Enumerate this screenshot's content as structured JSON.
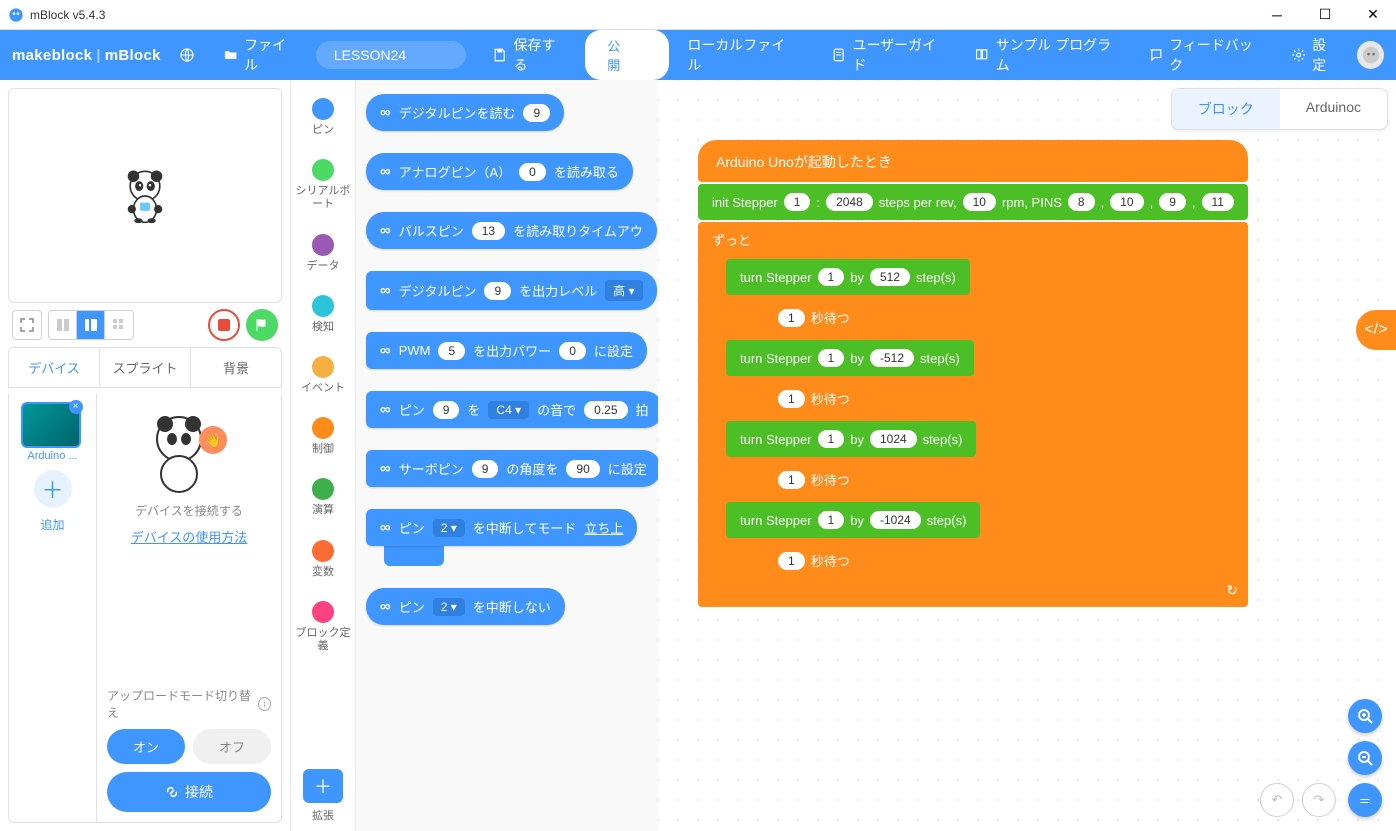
{
  "titlebar": {
    "title": "mBlock v5.4.3"
  },
  "header": {
    "logo_left": "makeblock",
    "logo_right": "mBlock",
    "file": "ファイル",
    "project_name": "LESSON24",
    "save": "保存する",
    "publish": "公 開",
    "local_file": "ローカルファイル",
    "user_guide": "ユーザーガイド",
    "samples": "サンプル プログラム",
    "feedback": "フィードバック",
    "settings": "設定"
  },
  "stage": {},
  "tabs": {
    "device": "デバイス",
    "sprite": "スプライト",
    "backdrop": "背景"
  },
  "device": {
    "name": "Arduino ...",
    "add": "追加",
    "connect_hint": "デバイスを接続する",
    "usage_link": "デバイスの使用方法",
    "upload_mode": "アップロードモード切り替え",
    "on": "オン",
    "off": "オフ",
    "connect": "接続"
  },
  "categories": [
    {
      "label": "ピン",
      "color": "#4096ff"
    },
    {
      "label": "シリアルポート",
      "color": "#4cd964"
    },
    {
      "label": "データ",
      "color": "#9b59b6"
    },
    {
      "label": "検知",
      "color": "#2bc4d8"
    },
    {
      "label": "イベント",
      "color": "#f5b041"
    },
    {
      "label": "制御",
      "color": "#ff8c1a"
    },
    {
      "label": "演算",
      "color": "#3eb049"
    },
    {
      "label": "変数",
      "color": "#ff6b35"
    },
    {
      "label": "ブロック定義",
      "color": "#ff4081"
    }
  ],
  "ext": {
    "label": "拡張"
  },
  "palette": [
    {
      "parts": [
        "∞",
        "デジタルピンを読む",
        {
          "pill": "9"
        }
      ]
    },
    {
      "parts": [
        "∞",
        "アナログピン（A）",
        {
          "pill": "0"
        },
        "を読み取る"
      ]
    },
    {
      "parts": [
        "∞",
        "パルスピン",
        {
          "pill": "13"
        },
        "を読み取りタイムアウ"
      ]
    },
    {
      "parts": [
        "∞",
        "デジタルピン",
        {
          "pill": "9"
        },
        "を出力レベル",
        {
          "drop": "高 ▾"
        }
      ]
    },
    {
      "parts": [
        "∞",
        "PWM",
        {
          "pill": "5"
        },
        "を出力パワー",
        {
          "pill": "0"
        },
        "に設定"
      ]
    },
    {
      "parts": [
        "∞",
        "ピン",
        {
          "pill": "9"
        },
        "を",
        {
          "drop": "C4 ▾"
        },
        "の音で",
        {
          "pill": "0.25"
        },
        "拍"
      ]
    },
    {
      "parts": [
        "∞",
        "サーボピン",
        {
          "pill": "9"
        },
        "の角度を",
        {
          "pill": "90"
        },
        "に設定"
      ]
    },
    {
      "parts": [
        "∞",
        "ピン",
        {
          "drop": "2 ▾"
        },
        "を中断してモード",
        {
          "u": "立ち上"
        }
      ]
    },
    {
      "parts": [
        "∞",
        "ピン",
        {
          "drop": "2 ▾"
        },
        "を中断しない"
      ]
    }
  ],
  "canvas_tabs": {
    "blocks": "ブロック",
    "code": "Arduinoc"
  },
  "script": {
    "hat": "Arduino Unoが起動したとき",
    "init": {
      "label": "init Stepper",
      "id": "1",
      "steps": "2048",
      "spr": "steps per rev,",
      "rpm": "10",
      "rpml": "rpm, PINS",
      "p1": "8",
      "c1": ",",
      "p2": "10",
      "c2": ",",
      "p3": "9",
      "c3": ",",
      "p4": "11"
    },
    "forever": "ずっと",
    "turn_label": "turn Stepper",
    "by": "by",
    "steps_label": "step(s)",
    "wait_label": "秒待つ",
    "wait_val": "1",
    "turns": [
      {
        "id": "1",
        "val": "512"
      },
      {
        "id": "1",
        "val": "-512"
      },
      {
        "id": "1",
        "val": "1024"
      },
      {
        "id": "1",
        "val": "-1024"
      }
    ]
  }
}
